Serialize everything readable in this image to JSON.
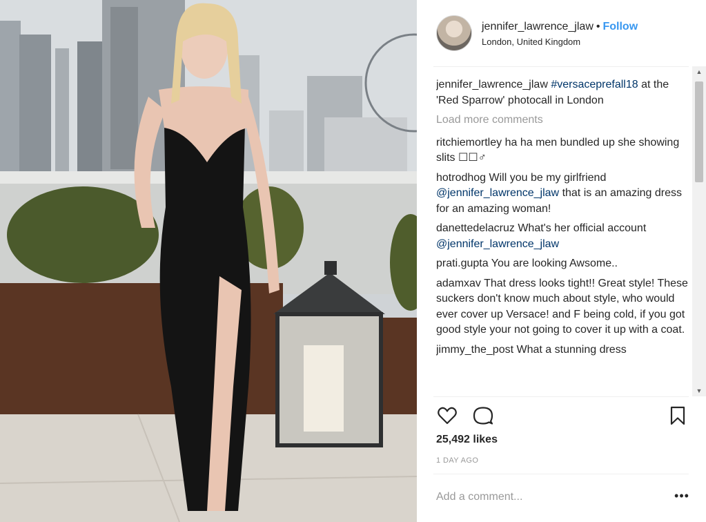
{
  "post": {
    "username": "jennifer_lawrence_jlaw",
    "separator": "•",
    "follow_label": "Follow",
    "location": "London, United Kingdom",
    "photo_description_icon": "post-photo",
    "likes": "25,492 likes",
    "time_ago": "1 DAY AGO",
    "add_comment_placeholder": "Add a comment...",
    "more_options_label": "•••"
  },
  "caption": {
    "user": "jennifer_lawrence_jlaw",
    "hashtag": "#versaceprefall18",
    "text_after_tag": "at the 'Red Sparrow' photocall in London"
  },
  "load_more_label": "Load more comments",
  "comments": [
    {
      "user": "ritchiemortley",
      "text": "ha ha men bundled up she showing slits ☐☐♂"
    },
    {
      "user": "hotrodhog",
      "text": "Will you be my girlfriend",
      "mention": "@jennifer_lawrence_jlaw",
      "text_after": "that is an amazing dress for an amazing woman!"
    },
    {
      "user": "danettedelacruz",
      "text": "What's her official account",
      "mention": "@jennifer_lawrence_jlaw",
      "text_after": ""
    },
    {
      "user": "prati.gupta",
      "text": "You are looking Awsome.."
    },
    {
      "user": "adamxav",
      "text": "That dress looks tight!! Great style! These suckers don't know much about style, who would ever cover up Versace! and F being cold, if you got good style your not going to cover it up with a coat."
    },
    {
      "user": "jimmy_the_post",
      "text": "What a stunning dress"
    }
  ],
  "icons": {
    "like": "heart-icon",
    "comment": "comment-bubble-icon",
    "save": "bookmark-icon"
  },
  "colors": {
    "link_blue": "#3897f0",
    "hashtag": "#003569",
    "muted": "#999999",
    "text": "#262626"
  }
}
